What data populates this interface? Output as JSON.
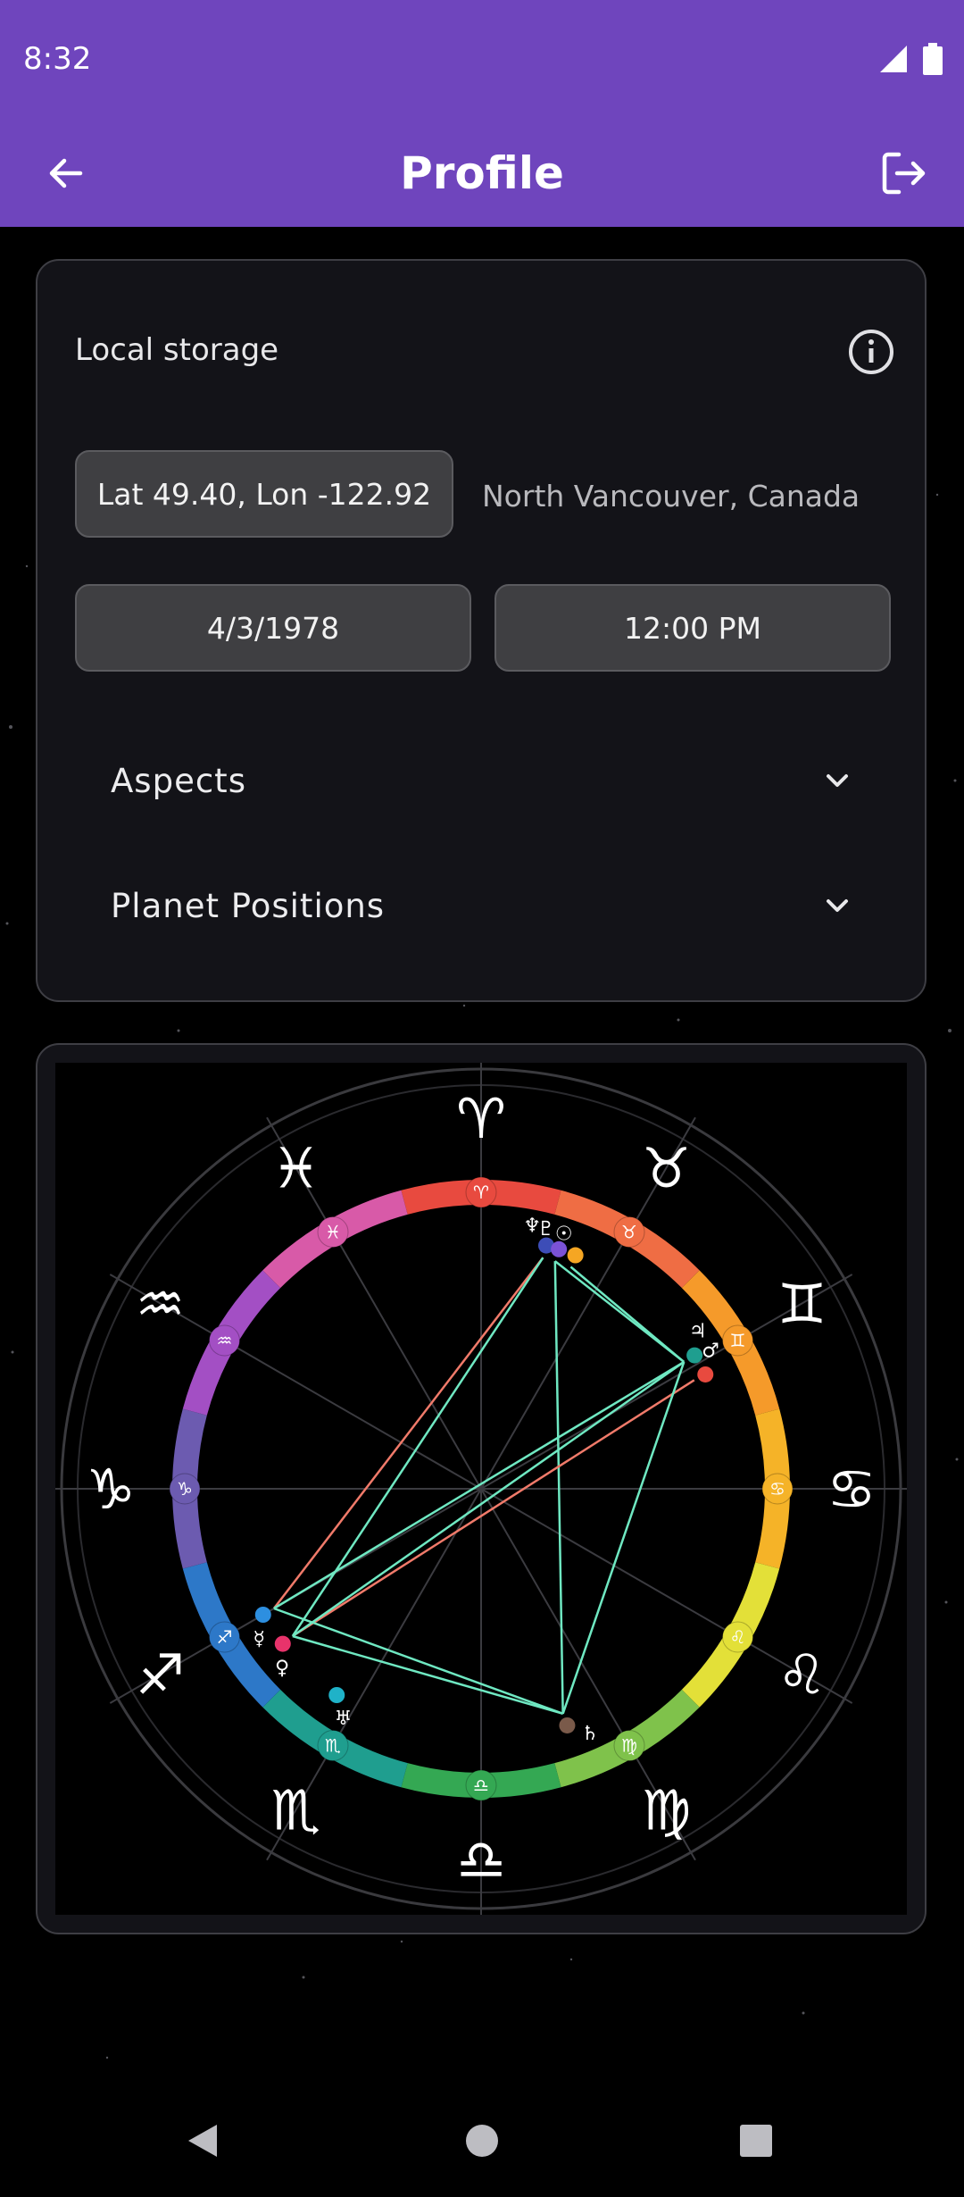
{
  "status_bar": {
    "time": "8:32",
    "icons": [
      "signal-icon",
      "battery-icon"
    ]
  },
  "app_bar": {
    "title": "Profile",
    "back_icon": "arrow-back-icon",
    "logout_icon": "logout-icon"
  },
  "profile_card": {
    "storage_label": "Local storage",
    "info_icon": "info-icon",
    "coordinates": "Lat 49.40, Lon -122.92",
    "place": "North Vancouver, Canada",
    "date": "4/3/1978",
    "time": "12:00 PM",
    "expanders": [
      {
        "label": "Aspects",
        "icon": "chevron-down-icon"
      },
      {
        "label": "Planet Positions",
        "icon": "chevron-down-icon"
      }
    ]
  },
  "chart": {
    "signs": [
      {
        "name": "Aries",
        "glyph": "♈",
        "color": "#e84a3f"
      },
      {
        "name": "Taurus",
        "glyph": "♉",
        "color": "#ef6d44"
      },
      {
        "name": "Gemini",
        "glyph": "♊",
        "color": "#f59a2a"
      },
      {
        "name": "Cancer",
        "glyph": "♋",
        "color": "#f5b328"
      },
      {
        "name": "Leo",
        "glyph": "♌",
        "color": "#e3e038"
      },
      {
        "name": "Virgo",
        "glyph": "♍",
        "color": "#7fc24b"
      },
      {
        "name": "Libra",
        "glyph": "♎",
        "color": "#34a853"
      },
      {
        "name": "Scorpio",
        "glyph": "♏",
        "color": "#1f9e8f"
      },
      {
        "name": "Sagittarius",
        "glyph": "♐",
        "color": "#2d78c8"
      },
      {
        "name": "Capricorn",
        "glyph": "♑",
        "color": "#6c5bb0"
      },
      {
        "name": "Aquarius",
        "glyph": "♒",
        "color": "#a34fc4"
      },
      {
        "name": "Pisces",
        "glyph": "♓",
        "color": "#d85aa8"
      }
    ],
    "planets": [
      {
        "name": "Neptune",
        "glyph": "♆",
        "color": "#3d4db7"
      },
      {
        "name": "Pluto",
        "glyph": "♇",
        "color": "#7b52d6"
      },
      {
        "name": "Sun",
        "glyph": "☉",
        "color": "#f5a623"
      },
      {
        "name": "Jupiter",
        "glyph": "♃",
        "color": "#1f9e8f"
      },
      {
        "name": "Mars",
        "glyph": "♂",
        "color": "#e84a3f"
      },
      {
        "name": "Mercury",
        "glyph": "☿",
        "color": "#2d8fe0"
      },
      {
        "name": "Venus",
        "glyph": "♀",
        "color": "#e8336b"
      },
      {
        "name": "Uranus",
        "glyph": "♅",
        "color": "#1fb2c8"
      },
      {
        "name": "Saturn",
        "glyph": "♄",
        "color": "#7a5a4a"
      }
    ],
    "aspect_colors": {
      "harmonious": "#6fe8c2",
      "tense": "#f07a6a"
    }
  },
  "nav_bar": {
    "icons": [
      "nav-back-icon",
      "nav-home-icon",
      "nav-recents-icon"
    ]
  }
}
